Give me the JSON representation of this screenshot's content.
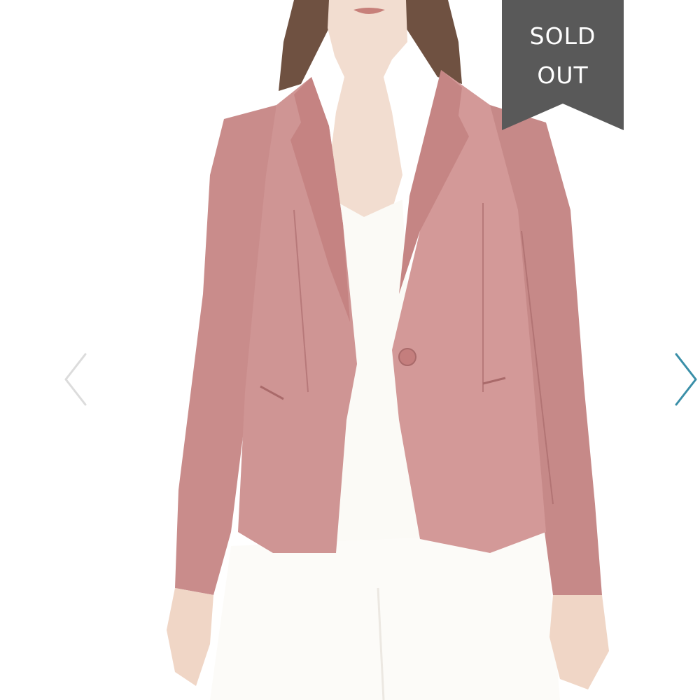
{
  "badge": {
    "line1": "SOLD",
    "line2": "OUT",
    "color": "#595959"
  },
  "navigation": {
    "prev_icon": "chevron-left-icon",
    "next_icon": "chevron-right-icon",
    "prev_color": "#dcdcdc",
    "next_color": "#3a8fa8"
  },
  "product_image": {
    "subject": "pink-blazer-photo",
    "jacket_color": "#c98d8c",
    "top_color": "#fbfaf7",
    "hair_color": "#6e5040"
  }
}
